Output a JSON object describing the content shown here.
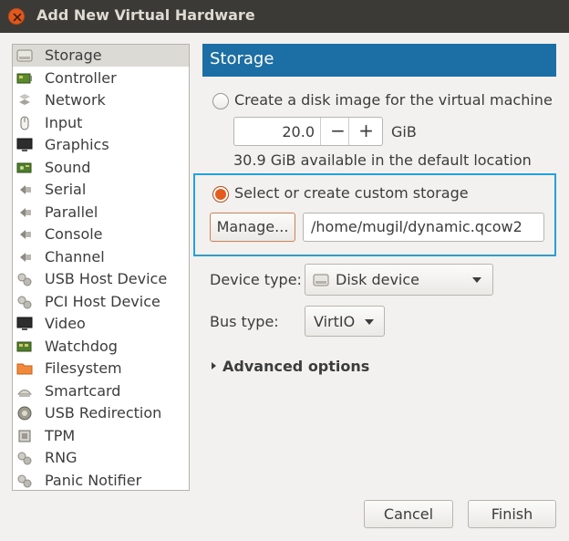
{
  "window": {
    "title": "Add New Virtual Hardware"
  },
  "sidebar": {
    "selected": "Storage",
    "items": [
      {
        "label": "Storage",
        "icon": "storage-icon"
      },
      {
        "label": "Controller",
        "icon": "controller-icon"
      },
      {
        "label": "Network",
        "icon": "network-icon"
      },
      {
        "label": "Input",
        "icon": "mouse-icon"
      },
      {
        "label": "Graphics",
        "icon": "monitor-icon"
      },
      {
        "label": "Sound",
        "icon": "sound-card-icon"
      },
      {
        "label": "Serial",
        "icon": "serial-port-icon"
      },
      {
        "label": "Parallel",
        "icon": "parallel-port-icon"
      },
      {
        "label": "Console",
        "icon": "console-port-icon"
      },
      {
        "label": "Channel",
        "icon": "channel-port-icon"
      },
      {
        "label": "USB Host Device",
        "icon": "usb-host-icon"
      },
      {
        "label": "PCI Host Device",
        "icon": "pci-host-icon"
      },
      {
        "label": "Video",
        "icon": "video-monitor-icon"
      },
      {
        "label": "Watchdog",
        "icon": "watchdog-icon"
      },
      {
        "label": "Filesystem",
        "icon": "folder-icon"
      },
      {
        "label": "Smartcard",
        "icon": "smartcard-icon"
      },
      {
        "label": "USB Redirection",
        "icon": "usb-redirection-icon"
      },
      {
        "label": "TPM",
        "icon": "tpm-chip-icon"
      },
      {
        "label": "RNG",
        "icon": "rng-icon"
      },
      {
        "label": "Panic Notifier",
        "icon": "panic-notifier-icon"
      }
    ]
  },
  "storage": {
    "header": "Storage",
    "create_disk_label": "Create a disk image for the virtual machine",
    "disk_size_value": "20.0",
    "minus_label": "−",
    "plus_label": "+",
    "size_unit": "GiB",
    "available_text": "30.9 GiB available in the default location",
    "custom_storage_label": "Select or create custom storage",
    "manage_label": "Manage...",
    "path_value": "/home/mugil/dynamic.qcow2",
    "device_type_label": "Device type:",
    "device_type_value": "Disk device",
    "bus_type_label": "Bus type:",
    "bus_type_value": "VirtIO",
    "advanced_label": "Advanced options"
  },
  "footer": {
    "cancel_label": "Cancel",
    "finish_label": "Finish"
  },
  "colors": {
    "header_bg": "#1c6fa4",
    "titlebar_bg": "#3b3a36",
    "radio_accent": "#e45c1d",
    "highlight_border": "#2a9fd6"
  }
}
